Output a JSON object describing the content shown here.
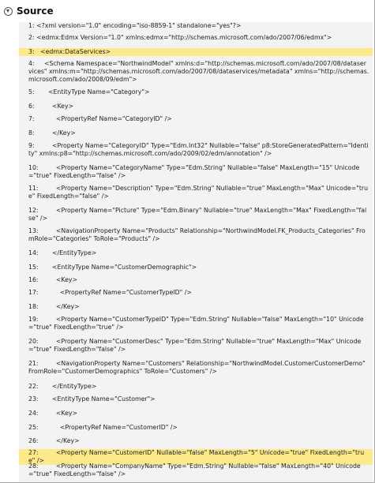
{
  "header": {
    "title": "Source",
    "toggle_icon": "collapse-circle-icon"
  },
  "colors": {
    "panel_background": "#f3f3f3",
    "highlight": "#fbe98a"
  },
  "lines": [
    {
      "n": "1:",
      "text": "<?xml version=\"1.0\" encoding=\"iso-8859-1\" standalone=\"yes\"?>",
      "highlighted": false
    },
    {
      "n": "2:",
      "text": "<edmx:Edmx Version=\"1.0\" xmlns:edmx=\"http://schemas.microsoft.com/ado/2007/06/edmx\">",
      "highlighted": false
    },
    {
      "n": "3:",
      "text": "  <edmx:DataServices>",
      "highlighted": true
    },
    {
      "n": "4:",
      "text": "    <Schema Namespace=\"NorthwindModel\" xmlns:d=\"http://schemas.microsoft.com/ado/2007/08/dataservices\" xmlns:m=\"http://schemas.microsoft.com/ado/2007/08/dataservices/metadata\" xmlns=\"http://schemas.microsoft.com/ado/2008/09/edm\">",
      "highlighted": false
    },
    {
      "n": "5:",
      "text": "      <EntityType Name=\"Category\">",
      "highlighted": false
    },
    {
      "n": "6:",
      "text": "        <Key>",
      "highlighted": false
    },
    {
      "n": "7:",
      "text": "          <PropertyRef Name=\"CategoryID\" />",
      "highlighted": false
    },
    {
      "n": "8:",
      "text": "        </Key>",
      "highlighted": false
    },
    {
      "n": "9:",
      "text": "        <Property Name=\"CategoryID\" Type=\"Edm.Int32\" Nullable=\"false\" p8:StoreGeneratedPattern=\"Identity\" xmlns:p8=\"http://schemas.microsoft.com/ado/2009/02/edm/annotation\" />",
      "highlighted": false
    },
    {
      "n": "10:",
      "text": "        <Property Name=\"CategoryName\" Type=\"Edm.String\" Nullable=\"false\" MaxLength=\"15\" Unicode=\"true\" FixedLength=\"false\" />",
      "highlighted": false
    },
    {
      "n": "11:",
      "text": "        <Property Name=\"Description\" Type=\"Edm.String\" Nullable=\"true\" MaxLength=\"Max\" Unicode=\"true\" FixedLength=\"false\" />",
      "highlighted": false
    },
    {
      "n": "12:",
      "text": "        <Property Name=\"Picture\" Type=\"Edm.Binary\" Nullable=\"true\" MaxLength=\"Max\" FixedLength=\"false\" />",
      "highlighted": false
    },
    {
      "n": "13:",
      "text": "        <NavigationProperty Name=\"Products\" Relationship=\"NorthwindModel.FK_Products_Categories\" FromRole=\"Categories\" ToRole=\"Products\" />",
      "highlighted": false
    },
    {
      "n": "14:",
      "text": "      </EntityType>",
      "highlighted": false
    },
    {
      "n": "15:",
      "text": "      <EntityType Name=\"CustomerDemographic\">",
      "highlighted": false
    },
    {
      "n": "16:",
      "text": "        <Key>",
      "highlighted": false
    },
    {
      "n": "17:",
      "text": "          <PropertyRef Name=\"CustomerTypeID\" />",
      "highlighted": false
    },
    {
      "n": "18:",
      "text": "        </Key>",
      "highlighted": false
    },
    {
      "n": "19:",
      "text": "        <Property Name=\"CustomerTypeID\" Type=\"Edm.String\" Nullable=\"false\" MaxLength=\"10\" Unicode=\"true\" FixedLength=\"true\" />",
      "highlighted": false
    },
    {
      "n": "20:",
      "text": "        <Property Name=\"CustomerDesc\" Type=\"Edm.String\" Nullable=\"true\" MaxLength=\"Max\" Unicode=\"true\" FixedLength=\"false\" />",
      "highlighted": false
    },
    {
      "n": "21:",
      "text": "        <NavigationProperty Name=\"Customers\" Relationship=\"NorthwindModel.CustomerCustomerDemo\" FromRole=\"CustomerDemographics\" ToRole=\"Customers\" />",
      "highlighted": false
    },
    {
      "n": "22:",
      "text": "      </EntityType>",
      "highlighted": false
    },
    {
      "n": "23:",
      "text": "      <EntityType Name=\"Customer\">",
      "highlighted": false
    },
    {
      "n": "24:",
      "text": "        <Key>",
      "highlighted": false
    },
    {
      "n": "25:",
      "text": "          <PropertyRef Name=\"CustomerID\" />",
      "highlighted": false
    },
    {
      "n": "26:",
      "text": "        </Key>",
      "highlighted": false
    },
    {
      "n": "27:",
      "text": "        <Property Name=\"CustomerID\" Nullable=\"false\" MaxLength=\"5\" Unicode=\"true\" FixedLength=\"true\" />",
      "highlighted": true
    },
    {
      "n": "28:",
      "text": "        <Property Name=\"CompanyName\" Type=\"Edm.String\" Nullable=\"false\" MaxLength=\"40\" Unicode=\"true\" FixedLength=\"false\" />",
      "highlighted": false
    }
  ]
}
